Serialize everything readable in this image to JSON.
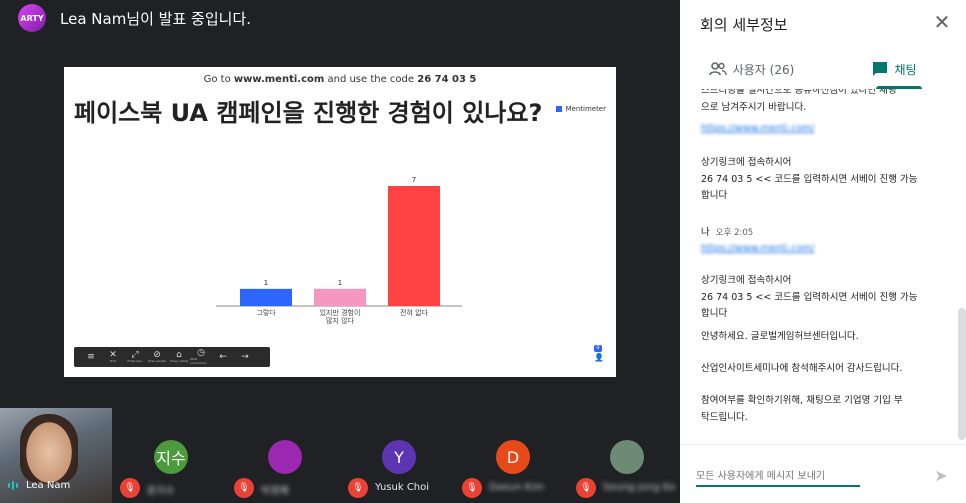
{
  "top": {
    "logo_text": "ARTY",
    "presenter_text": "Lea Nam님이 발표 중입니다."
  },
  "slide": {
    "header_prefix": "Go to ",
    "header_site": "www.menti.com",
    "header_mid": " and use the code ",
    "header_code": "26 74 03 5",
    "question": "페이스북 UA 캠페인을 진행한 경험이 있나요?",
    "brand": "Mentimeter",
    "presence_count": "0",
    "toolbar": [
      {
        "icon": "≡",
        "label": ""
      },
      {
        "icon": "✕",
        "label": "Exit"
      },
      {
        "icon": "⤢",
        "label": "Fullscreen"
      },
      {
        "icon": "⊘",
        "label": "Hide results"
      },
      {
        "icon": "⌂",
        "label": "Close voting"
      },
      {
        "icon": "◷",
        "label": "Start countdown"
      },
      {
        "icon": "←",
        "label": ""
      },
      {
        "icon": "→",
        "label": ""
      }
    ]
  },
  "chart_data": {
    "type": "bar",
    "categories": [
      "그렇다",
      "있지만 경험이 많지 않다",
      "전혀 없다"
    ],
    "category_lines": [
      [
        "그렇다"
      ],
      [
        "있지만 경험이",
        "많지 않다"
      ],
      [
        "전혀 없다"
      ]
    ],
    "values": [
      1,
      1,
      7
    ],
    "colors": [
      "#2c66ff",
      "#f597c0",
      "#ff4242"
    ],
    "title": "",
    "ylim": [
      0,
      7
    ]
  },
  "participants": {
    "self": {
      "name": "Lea Nam"
    },
    "tiles": [
      {
        "initial": "지수",
        "color": "#4b9b3c",
        "name": "윤지수",
        "blur": true
      },
      {
        "initial": "",
        "color": "#9c27b0",
        "name": "박영혜",
        "blur": true
      },
      {
        "initial": "Y",
        "color": "#5e35b1",
        "name": "Yusuk Choi",
        "blur": false
      },
      {
        "initial": "D",
        "color": "#e64a19",
        "name": "Daeun Kim",
        "blur": true
      },
      {
        "initial": "",
        "color": "#6d8b74",
        "name": "Seung-jong Ko",
        "blur": true
      }
    ]
  },
  "panel": {
    "title": "회의 세부정보",
    "tab_people": "사용자 (26)",
    "tab_chat": "채팅",
    "messages": [
      {
        "lines": [
          "스트리밍을 실시간으로 공유하신점이 있다면 채팅",
          "으로 남겨주시기 바랍니다."
        ]
      },
      {
        "link": "https://www.menti.com/"
      },
      {
        "lines": [
          "상기링크에 접속하시어",
          "26 74 03 5  << 코드를 입력하시면 서베이 진행 가능",
          "합니다"
        ]
      },
      {
        "sender": "나",
        "time": "오후 2:05"
      },
      {
        "link": "https://www.menti.com/"
      },
      {
        "lines": [
          "상기링크에 접속하시어",
          "26 74 03 5  << 코드를 입력하시면 서베이 진행 가능",
          "합니다"
        ]
      },
      {
        "lines": [
          "안녕하세요. 글로벌게임허브센터입니다."
        ]
      },
      {
        "lines": [
          "산업인사이트세미나에 참석해주시어 감사드립니다."
        ]
      },
      {
        "lines": [
          "참여여부를 확인하기위해, 채팅으로 기업명 기입 부",
          "탁드립니다."
        ]
      }
    ],
    "input_placeholder": "모든 사용자에게 메시지 보내기"
  }
}
